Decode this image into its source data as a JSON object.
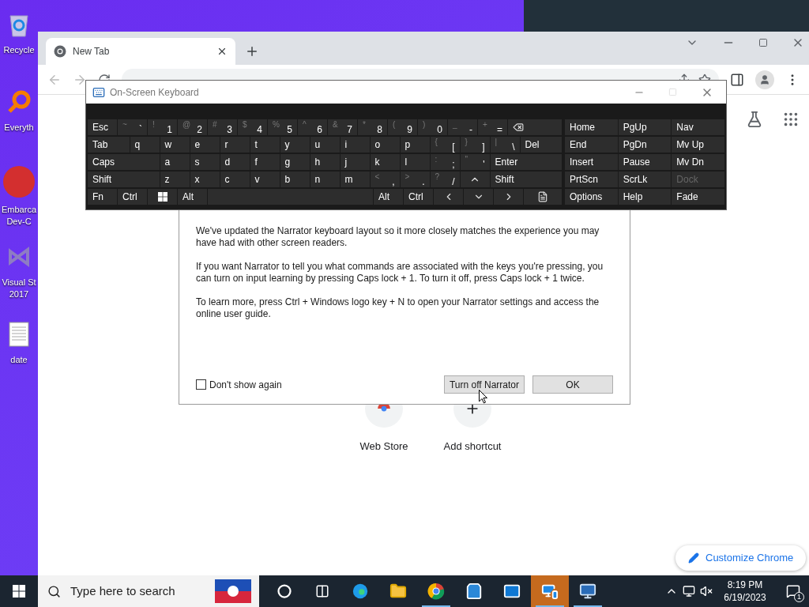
{
  "desktop": {
    "icons": [
      {
        "kind": "recycle",
        "lines": [
          "Recycle"
        ]
      },
      {
        "kind": "magnifier",
        "lines": [
          "Everyth"
        ]
      },
      {
        "kind": "devcpp",
        "lines": [
          "Embarca",
          "Dev-C"
        ]
      },
      {
        "kind": "visualstudio",
        "lines": [
          "Visual St",
          "2017"
        ]
      },
      {
        "kind": "document",
        "lines": [
          "date"
        ]
      }
    ]
  },
  "browser": {
    "tabs": [
      {
        "title": "New Tab",
        "selected": true
      }
    ],
    "shortcuts": [
      {
        "kind": "webstore",
        "label": "Web Store"
      },
      {
        "kind": "add",
        "label": "Add shortcut"
      }
    ],
    "customize_button": "Customize Chrome"
  },
  "narrator_dialog": {
    "paragraphs": [
      "We've updated the Narrator keyboard layout so it more closely matches the experience you may have had with other screen readers.",
      "If you want Narrator to tell you what commands are associated with the keys you're pressing, you can turn on input learning by pressing Caps lock + 1. To turn it off, press Caps lock + 1 twice.",
      "To learn more, press Ctrl + Windows logo key + N to open your Narrator settings and access the online user guide."
    ],
    "checkbox": {
      "label": "Don't show again",
      "checked": false
    },
    "buttons": [
      "Turn off Narrator",
      "OK"
    ]
  },
  "keyboard": {
    "title": "On-Screen Keyboard",
    "rows": [
      [
        {
          "kind": "text",
          "label": "Esc"
        },
        {
          "kind": "dual",
          "shift": "~",
          "label": "`"
        },
        {
          "kind": "dual",
          "shift": "!",
          "label": "1"
        },
        {
          "kind": "dual",
          "shift": "@",
          "label": "2"
        },
        {
          "kind": "dual",
          "shift": "#",
          "label": "3"
        },
        {
          "kind": "dual",
          "shift": "$",
          "label": "4"
        },
        {
          "kind": "dual",
          "shift": "%",
          "label": "5"
        },
        {
          "kind": "dual",
          "shift": "^",
          "label": "6"
        },
        {
          "kind": "dual",
          "shift": "&",
          "label": "7"
        },
        {
          "kind": "dual",
          "shift": "*",
          "label": "8"
        },
        {
          "kind": "dual",
          "shift": "(",
          "label": "9"
        },
        {
          "kind": "dual",
          "shift": ")",
          "label": "0"
        },
        {
          "kind": "dual",
          "shift": "_",
          "label": "-"
        },
        {
          "kind": "dual",
          "shift": "+",
          "label": "="
        },
        {
          "kind": "backspace"
        }
      ],
      [
        {
          "kind": "wide",
          "label": "Tab"
        },
        {
          "kind": "text",
          "label": "q"
        },
        {
          "kind": "text",
          "label": "w"
        },
        {
          "kind": "text",
          "label": "e"
        },
        {
          "kind": "text",
          "label": "r"
        },
        {
          "kind": "text",
          "label": "t"
        },
        {
          "kind": "text",
          "label": "y"
        },
        {
          "kind": "text",
          "label": "u"
        },
        {
          "kind": "text",
          "label": "i"
        },
        {
          "kind": "text",
          "label": "o"
        },
        {
          "kind": "text",
          "label": "p"
        },
        {
          "kind": "dual",
          "shift": "{",
          "label": "["
        },
        {
          "kind": "dual",
          "shift": "}",
          "label": "]"
        },
        {
          "kind": "dual",
          "shift": "|",
          "label": "\\"
        },
        {
          "kind": "wide",
          "label": "Del"
        }
      ],
      [
        {
          "kind": "wide",
          "label": "Caps"
        },
        {
          "kind": "text",
          "label": "a"
        },
        {
          "kind": "text",
          "label": "s"
        },
        {
          "kind": "text",
          "label": "d"
        },
        {
          "kind": "text",
          "label": "f"
        },
        {
          "kind": "text",
          "label": "g"
        },
        {
          "kind": "text",
          "label": "h"
        },
        {
          "kind": "text",
          "label": "j"
        },
        {
          "kind": "text",
          "label": "k"
        },
        {
          "kind": "text",
          "label": "l"
        },
        {
          "kind": "dual",
          "shift": ":",
          "label": ";"
        },
        {
          "kind": "dual",
          "shift": "\"",
          "label": "'"
        },
        {
          "kind": "wide",
          "label": "Enter"
        }
      ],
      [
        {
          "kind": "wide",
          "label": "Shift"
        },
        {
          "kind": "text",
          "label": "z"
        },
        {
          "kind": "text",
          "label": "x"
        },
        {
          "kind": "text",
          "label": "c"
        },
        {
          "kind": "text",
          "label": "v"
        },
        {
          "kind": "text",
          "label": "b"
        },
        {
          "kind": "text",
          "label": "n"
        },
        {
          "kind": "text",
          "label": "m"
        },
        {
          "kind": "dual",
          "shift": "<",
          "label": ","
        },
        {
          "kind": "dual",
          "shift": ">",
          "label": "."
        },
        {
          "kind": "dual",
          "shift": "?",
          "label": "/"
        },
        {
          "kind": "up"
        },
        {
          "kind": "wide",
          "label": "Shift"
        }
      ],
      [
        {
          "kind": "text",
          "label": "Fn"
        },
        {
          "kind": "text",
          "label": "Ctrl"
        },
        {
          "kind": "windows"
        },
        {
          "kind": "text",
          "label": "Alt"
        },
        {
          "kind": "space"
        },
        {
          "kind": "text",
          "label": "Alt"
        },
        {
          "kind": "text",
          "label": "Ctrl"
        },
        {
          "kind": "left"
        },
        {
          "kind": "down"
        },
        {
          "kind": "right"
        },
        {
          "kind": "menu"
        }
      ]
    ],
    "nav_keys": [
      [
        {
          "label": "Home",
          "disabled": false
        },
        {
          "label": "PgUp",
          "disabled": false
        },
        {
          "label": "Nav",
          "disabled": false
        }
      ],
      [
        {
          "label": "End",
          "disabled": false
        },
        {
          "label": "PgDn",
          "disabled": false
        },
        {
          "label": "Mv Up",
          "disabled": false
        }
      ],
      [
        {
          "label": "Insert",
          "disabled": false
        },
        {
          "label": "Pause",
          "disabled": false
        },
        {
          "label": "Mv Dn",
          "disabled": false
        }
      ],
      [
        {
          "label": "PrtScn",
          "disabled": false
        },
        {
          "label": "ScrLk",
          "disabled": false
        },
        {
          "label": "Dock",
          "disabled": true
        }
      ],
      [
        {
          "label": "Options",
          "disabled": false
        },
        {
          "label": "Help",
          "disabled": false
        },
        {
          "label": "Fade",
          "disabled": false
        }
      ]
    ]
  },
  "taskbar": {
    "search_placeholder": "Type here to search",
    "apps": [
      {
        "kind": "cortana",
        "running": false,
        "selected": false
      },
      {
        "kind": "taskview",
        "running": false,
        "selected": false
      },
      {
        "kind": "edge",
        "running": false,
        "selected": false
      },
      {
        "kind": "folder",
        "running": false,
        "selected": false
      },
      {
        "kind": "chrome",
        "running": true,
        "selected": false
      },
      {
        "kind": "store",
        "running": false,
        "selected": false
      },
      {
        "kind": "mail",
        "running": false,
        "selected": false
      },
      {
        "kind": "remote",
        "running": true,
        "selected": true
      },
      {
        "kind": "monitor",
        "running": true,
        "selected": false
      }
    ],
    "time": "8:19 PM",
    "date": "6/19/2023",
    "notification_count": "1"
  }
}
